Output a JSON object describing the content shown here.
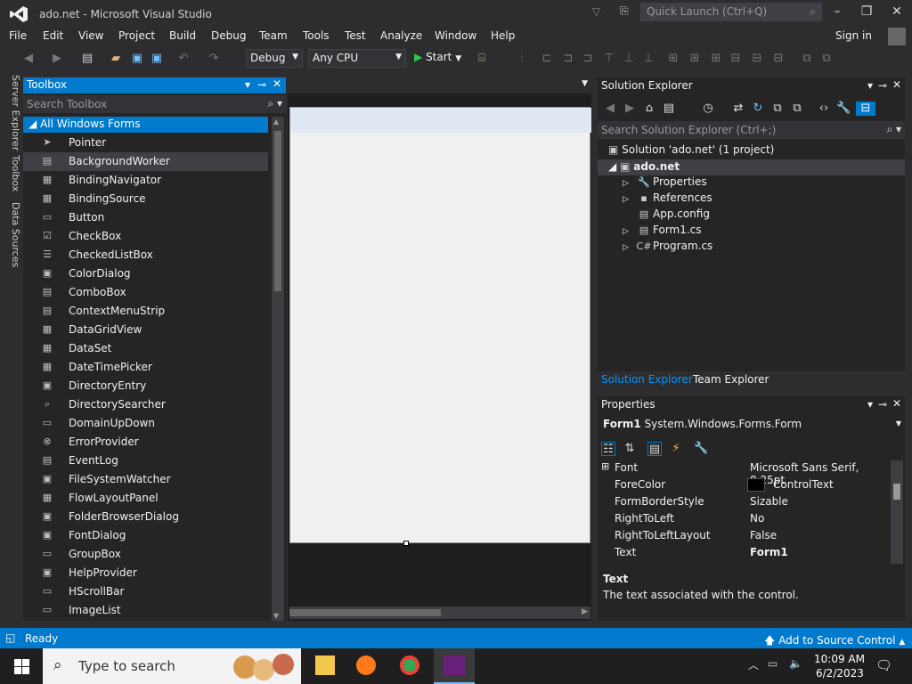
{
  "window": {
    "title": "ado.net - Microsoft Visual Studio",
    "quick_launch_placeholder": "Quick Launch (Ctrl+Q)",
    "signin": "Sign in"
  },
  "menu": [
    "File",
    "Edit",
    "View",
    "Project",
    "Build",
    "Debug",
    "Team",
    "Tools",
    "Test",
    "Analyze",
    "Window",
    "Help"
  ],
  "toolbar": {
    "config": "Debug",
    "platform": "Any CPU",
    "start": "Start"
  },
  "side_tabs": [
    "Server Explorer",
    "Toolbox",
    "Data Sources"
  ],
  "toolbox": {
    "title": "Toolbox",
    "search_placeholder": "Search Toolbox",
    "category": "All Windows Forms",
    "items": [
      "Pointer",
      "BackgroundWorker",
      "BindingNavigator",
      "BindingSource",
      "Button",
      "CheckBox",
      "CheckedListBox",
      "ColorDialog",
      "ComboBox",
      "ContextMenuStrip",
      "DataGridView",
      "DataSet",
      "DateTimePicker",
      "DirectoryEntry",
      "DirectorySearcher",
      "DomainUpDown",
      "ErrorProvider",
      "EventLog",
      "FileSystemWatcher",
      "FlowLayoutPanel",
      "FolderBrowserDialog",
      "FontDialog",
      "GroupBox",
      "HelpProvider",
      "HScrollBar",
      "ImageList"
    ]
  },
  "solution_explorer": {
    "title": "Solution Explorer",
    "search_placeholder": "Search Solution Explorer (Ctrl+;)",
    "solution": "Solution 'ado.net' (1 project)",
    "project": "ado.net",
    "nodes": [
      "Properties",
      "References",
      "App.config",
      "Form1.cs",
      "Program.cs"
    ],
    "tabs": [
      "Solution Explorer",
      "Team Explorer"
    ]
  },
  "properties": {
    "title": "Properties",
    "object": "Form1",
    "object_type": "System.Windows.Forms.Form",
    "rows": [
      {
        "name": "Font",
        "value": "Microsoft Sans Serif, 8.25pt"
      },
      {
        "name": "ForeColor",
        "value": "ControlText"
      },
      {
        "name": "FormBorderStyle",
        "value": "Sizable"
      },
      {
        "name": "RightToLeft",
        "value": "No"
      },
      {
        "name": "RightToLeftLayout",
        "value": "False"
      },
      {
        "name": "Text",
        "value": "Form1"
      }
    ],
    "desc_title": "Text",
    "desc": "The text associated with the control."
  },
  "status": {
    "text": "Ready",
    "source_control": "Add to Source Control"
  },
  "taskbar": {
    "search": "Type to search",
    "time": "10:09 AM",
    "date": "6/2/2023"
  },
  "colors": {
    "accent": "#007acc",
    "bg": "#2d2d30",
    "vs_purple": "#68217a"
  }
}
